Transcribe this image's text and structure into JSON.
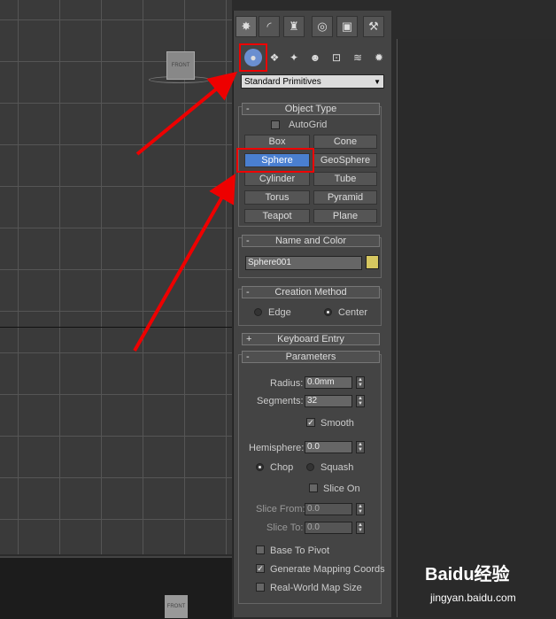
{
  "viewport": {
    "front_label": "FRONT",
    "bottom_label": "FRONT"
  },
  "tabs": [
    {
      "icon": "create-icon",
      "glyph": "✸"
    },
    {
      "icon": "modify-icon",
      "glyph": "◜"
    },
    {
      "icon": "hierarchy-icon",
      "glyph": "♜"
    },
    {
      "icon": "motion-icon",
      "glyph": "◎"
    },
    {
      "icon": "display-icon",
      "glyph": "▣"
    },
    {
      "icon": "utilities-icon",
      "glyph": "⚒"
    }
  ],
  "subtabs": [
    {
      "icon": "geometry-icon",
      "glyph": "●"
    },
    {
      "icon": "shapes-icon",
      "glyph": "❖"
    },
    {
      "icon": "lights-icon",
      "glyph": "✦"
    },
    {
      "icon": "cameras-icon",
      "glyph": "☻"
    },
    {
      "icon": "helpers-icon",
      "glyph": "⊡"
    },
    {
      "icon": "spacewarps-icon",
      "glyph": "≋"
    },
    {
      "icon": "systems-icon",
      "glyph": "✹"
    }
  ],
  "dropdown": {
    "value": "Standard Primitives"
  },
  "object_type": {
    "title": "Object Type",
    "collapse": "-",
    "autogrid": "AutoGrid",
    "buttons": [
      "Box",
      "Cone",
      "Sphere",
      "GeoSphere",
      "Cylinder",
      "Tube",
      "Torus",
      "Pyramid",
      "Teapot",
      "Plane"
    ],
    "active": "Sphere"
  },
  "name_color": {
    "title": "Name and Color",
    "collapse": "-",
    "name": "Sphere001",
    "color": "#d6c760"
  },
  "creation_method": {
    "title": "Creation Method",
    "collapse": "-",
    "edge": "Edge",
    "center": "Center"
  },
  "keyboard_entry": {
    "title": "Keyboard Entry",
    "collapse": "+"
  },
  "parameters": {
    "title": "Parameters",
    "collapse": "-",
    "radius_label": "Radius:",
    "radius": "0.0mm",
    "segments_label": "Segments:",
    "segments": "32",
    "smooth": "Smooth",
    "hemisphere_label": "Hemisphere:",
    "hemisphere": "0.0",
    "chop": "Chop",
    "squash": "Squash",
    "slice_on": "Slice On",
    "slice_from_label": "Slice From:",
    "slice_from": "0.0",
    "slice_to_label": "Slice To:",
    "slice_to": "0.0",
    "base_to_pivot": "Base To Pivot",
    "gen_mapping": "Generate Mapping Coords",
    "realworld": "Real-World Map Size"
  },
  "watermark": {
    "brand": "Baidu经验",
    "url": "jingyan.baidu.com"
  },
  "colors": {
    "accent": "#4a7fd0",
    "highlight": "#e00000"
  }
}
